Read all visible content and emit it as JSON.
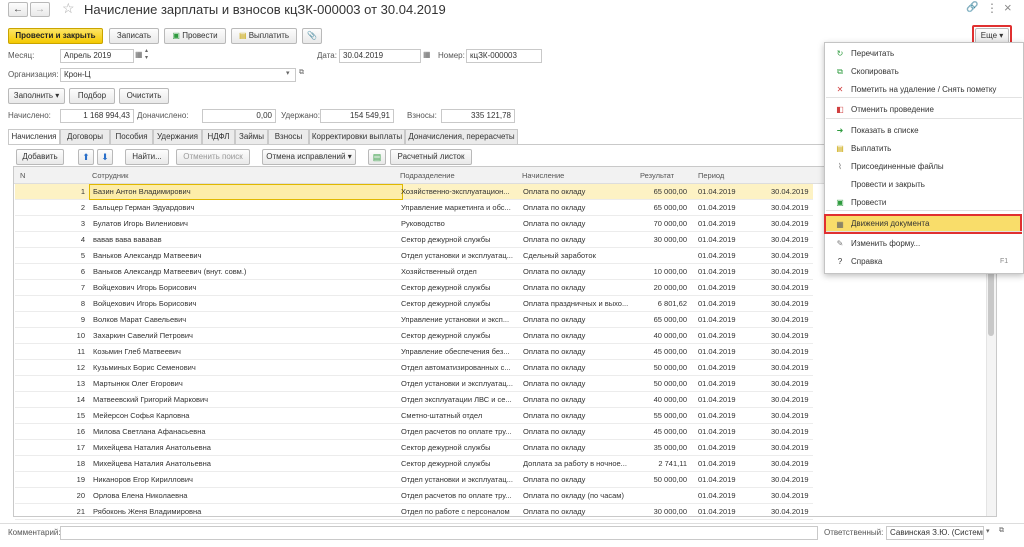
{
  "window": {
    "title": "Начисление зарплаты и взносов кцЗК-000003 от 30.04.2019",
    "back_label": "←",
    "forward_label": "→",
    "star_label": "☆",
    "link_label": "🔗",
    "more_dots": "⋮",
    "close_label": "×"
  },
  "toolbar": {
    "post_close": "Провести и закрыть",
    "save": "Записать",
    "post": "Провести",
    "pay": "Выплатить",
    "attach": "📎",
    "more": "Еще",
    "more_caret": "▾"
  },
  "form": {
    "month_label": "Месяц:",
    "month_value": "Апрель 2019",
    "date_label": "Дата:",
    "date_value": "30.04.2019",
    "number_label": "Номер:",
    "number_value": "кцЗК-000003",
    "org_label": "Организация:",
    "org_value": "Крон-Ц",
    "fill_button": "Заполнить",
    "select_button": "Подбор",
    "clear_button": "Очистить",
    "accrued_label": "Начислено:",
    "accrued_value": "1 168 994,43",
    "additional_label": "Доначислено:",
    "additional_value": "0,00",
    "withheld_label": "Удержано:",
    "withheld_value": "154 549,91",
    "contrib_label": "Взносы:",
    "contrib_value": "335 121,78",
    "comment_label": "Комментарий:",
    "comment_value": "",
    "responsible_label": "Ответственный:",
    "responsible_value": "Савинская З.Ю. (Системн"
  },
  "tabs": [
    {
      "label": "Начисления",
      "active": true
    },
    {
      "label": "Договоры",
      "active": false
    },
    {
      "label": "Пособия",
      "active": false
    },
    {
      "label": "Удержания",
      "active": false
    },
    {
      "label": "НДФЛ",
      "active": false
    },
    {
      "label": "Займы",
      "active": false
    },
    {
      "label": "Взносы",
      "active": false
    },
    {
      "label": "Корректировки выплаты",
      "active": false
    },
    {
      "label": "Доначисления, перерасчеты",
      "active": false
    }
  ],
  "table_toolbar": {
    "add": "Добавить",
    "up": "⬆",
    "down": "⬇",
    "find": "Найти...",
    "cancel_search": "Отменить поиск",
    "undo_changes": "Отмена исправлений",
    "payslip": "Расчетный листок"
  },
  "table": {
    "headers": [
      "N",
      "Сотрудник",
      "Подразделение",
      "Начисление",
      "Результат",
      "Период"
    ],
    "rows": [
      {
        "n": "1",
        "employee": "Базин Антон Владимирович",
        "dept": "Хозяйственно-эксплуатацион...",
        "accrual": "Оплата по окладу",
        "result": "65 000,00",
        "period": "01.04.2019",
        "end": "30.04.2019"
      },
      {
        "n": "2",
        "employee": "Бальцер Герман Эдуардович",
        "dept": "Управление маркетинга и обс...",
        "accrual": "Оплата по окладу",
        "result": "65 000,00",
        "period": "01.04.2019",
        "end": "30.04.2019"
      },
      {
        "n": "3",
        "employee": "Булатов Игорь Вилениович",
        "dept": "Руководство",
        "accrual": "Оплата по окладу",
        "result": "70 000,00",
        "period": "01.04.2019",
        "end": "30.04.2019"
      },
      {
        "n": "4",
        "employee": "вавав вава вававав",
        "dept": "Сектор дежурной службы",
        "accrual": "Оплата по окладу",
        "result": "30 000,00",
        "period": "01.04.2019",
        "end": "30.04.2019"
      },
      {
        "n": "5",
        "employee": "Ваньков Александр Матвеевич",
        "dept": "Отдел установки и эксплуатац...",
        "accrual": "Сдельный заработок",
        "result": "",
        "period": "01.04.2019",
        "end": "30.04.2019"
      },
      {
        "n": "6",
        "employee": "Ваньков Александр Матвеевич (внут. совм.)",
        "dept": "Хозяйственный отдел",
        "accrual": "Оплата по окладу",
        "result": "10 000,00",
        "period": "01.04.2019",
        "end": "30.04.2019"
      },
      {
        "n": "7",
        "employee": "Войцехович Игорь Борисович",
        "dept": "Сектор дежурной службы",
        "accrual": "Оплата по окладу",
        "result": "20 000,00",
        "period": "01.04.2019",
        "end": "30.04.2019"
      },
      {
        "n": "8",
        "employee": "Войцехович Игорь Борисович",
        "dept": "Сектор дежурной службы",
        "accrual": "Оплата праздничных и выхо...",
        "result": "6 801,62",
        "period": "01.04.2019",
        "end": "30.04.2019"
      },
      {
        "n": "9",
        "employee": "Волков Марат Савельевич",
        "dept": "Управление установки и эксп...",
        "accrual": "Оплата по окладу",
        "result": "65 000,00",
        "period": "01.04.2019",
        "end": "30.04.2019"
      },
      {
        "n": "10",
        "employee": "Захаркин Савелий Петрович",
        "dept": "Сектор дежурной службы",
        "accrual": "Оплата по окладу",
        "result": "40 000,00",
        "period": "01.04.2019",
        "end": "30.04.2019"
      },
      {
        "n": "11",
        "employee": "Козьмин Глеб Матвеевич",
        "dept": "Управление обеспечения без...",
        "accrual": "Оплата по окладу",
        "result": "45 000,00",
        "period": "01.04.2019",
        "end": "30.04.2019"
      },
      {
        "n": "12",
        "employee": "Кузьминых Борис Семенович",
        "dept": "Отдел автоматизированных с...",
        "accrual": "Оплата по окладу",
        "result": "50 000,00",
        "period": "01.04.2019",
        "end": "30.04.2019"
      },
      {
        "n": "13",
        "employee": "Мартынюк Олег Егорович",
        "dept": "Отдел установки и эксплуатац...",
        "accrual": "Оплата по окладу",
        "result": "50 000,00",
        "period": "01.04.2019",
        "end": "30.04.2019"
      },
      {
        "n": "14",
        "employee": "Матвеевский Григорий Маркович",
        "dept": "Отдел эксплуатации ЛВС и се...",
        "accrual": "Оплата по окладу",
        "result": "40 000,00",
        "period": "01.04.2019",
        "end": "30.04.2019"
      },
      {
        "n": "15",
        "employee": "Мейерсон Софья Карловна",
        "dept": "Сметно-штатный отдел",
        "accrual": "Оплата по окладу",
        "result": "55 000,00",
        "period": "01.04.2019",
        "end": "30.04.2019"
      },
      {
        "n": "16",
        "employee": "Милова Светлана Афанасьевна",
        "dept": "Отдел расчетов по оплате тру...",
        "accrual": "Оплата по окладу",
        "result": "45 000,00",
        "period": "01.04.2019",
        "end": "30.04.2019"
      },
      {
        "n": "17",
        "employee": "Михейцева Наталия Анатольевна",
        "dept": "Сектор дежурной службы",
        "accrual": "Оплата по окладу",
        "result": "35 000,00",
        "period": "01.04.2019",
        "end": "30.04.2019"
      },
      {
        "n": "18",
        "employee": "Михейцева Наталия Анатольевна",
        "dept": "Сектор дежурной службы",
        "accrual": "Доплата за работу в ночное...",
        "result": "2 741,11",
        "period": "01.04.2019",
        "end": "30.04.2019"
      },
      {
        "n": "19",
        "employee": "Никаноров Егор Кириллович",
        "dept": "Отдел установки и эксплуатац...",
        "accrual": "Оплата по окладу",
        "result": "50 000,00",
        "period": "01.04.2019",
        "end": "30.04.2019"
      },
      {
        "n": "20",
        "employee": "Орлова Елена Николаевна",
        "dept": "Отдел расчетов по оплате тру...",
        "accrual": "Оплата по окладу (по часам)",
        "result": "",
        "period": "01.04.2019",
        "end": "30.04.2019"
      },
      {
        "n": "21",
        "employee": "Рябоконь Женя Владимировна",
        "dept": "Отдел по работе с персоналом",
        "accrual": "Оплата по окладу",
        "result": "30 000,00",
        "period": "01.04.2019",
        "end": "30.04.2019"
      }
    ]
  },
  "more_menu": {
    "items": [
      {
        "icon": "↻",
        "label": "Перечитать",
        "color": "#2e9b3e"
      },
      {
        "icon": "⧉",
        "label": "Скопировать",
        "color": "#2e9b3e"
      },
      {
        "icon": "✕",
        "label": "Пометить на удаление / Снять пометку",
        "color": "#d04040"
      },
      {
        "icon": "◧",
        "label": "Отменить проведение",
        "color": "#d04040"
      },
      {
        "icon": "➜",
        "label": "Показать в списке",
        "color": "#2e9b3e"
      },
      {
        "icon": "▤",
        "label": "Выплатить",
        "color": "#c9a400"
      },
      {
        "icon": "⌇",
        "label": "Присоединенные файлы",
        "color": "#777777"
      },
      {
        "icon": "",
        "label": "Провести и закрыть",
        "color": "#777777"
      },
      {
        "icon": "▣",
        "label": "Провести",
        "color": "#2e9b3e"
      },
      {
        "icon": "▦",
        "label": "Движения документа",
        "color": "#666666"
      },
      {
        "icon": "✎",
        "label": "Изменить форму...",
        "color": "#777777"
      },
      {
        "icon": "?",
        "label": "Справка",
        "color": "#333333"
      }
    ],
    "help_shortcut": "F1"
  },
  "colors": {
    "accent_yellow": "#f4c900",
    "highlight_red": "#e03030",
    "selected_row": "#fdf2c4",
    "menu_hover": "#f9dd6a"
  }
}
